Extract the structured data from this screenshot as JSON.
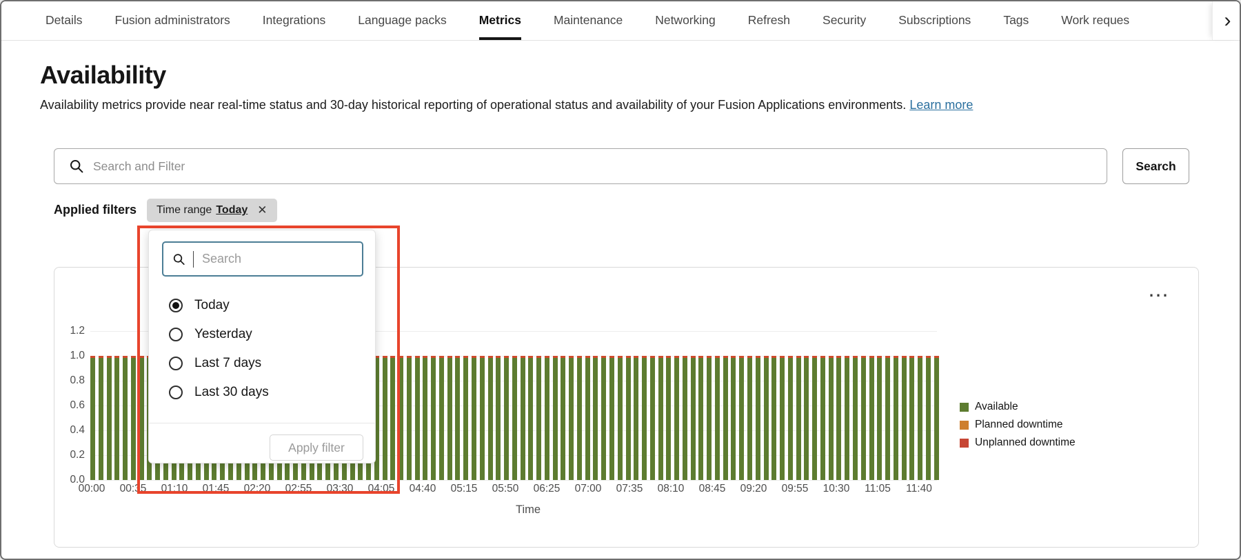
{
  "nav": {
    "tabs": [
      {
        "label": "Details",
        "active": false
      },
      {
        "label": "Fusion administrators",
        "active": false
      },
      {
        "label": "Integrations",
        "active": false
      },
      {
        "label": "Language packs",
        "active": false
      },
      {
        "label": "Metrics",
        "active": true
      },
      {
        "label": "Maintenance",
        "active": false
      },
      {
        "label": "Networking",
        "active": false
      },
      {
        "label": "Refresh",
        "active": false
      },
      {
        "label": "Security",
        "active": false
      },
      {
        "label": "Subscriptions",
        "active": false
      },
      {
        "label": "Tags",
        "active": false
      },
      {
        "label": "Work reques",
        "active": false
      }
    ],
    "overflow_icon": "chevron-right",
    "overflow_glyph": "›"
  },
  "header": {
    "title": "Availability",
    "description": "Availability metrics provide near real-time status and 30-day historical reporting of operational status and availability of your Fusion Applications environments.",
    "learn_more_label": "Learn more"
  },
  "search": {
    "placeholder": "Search and Filter",
    "button_label": "Search"
  },
  "filters": {
    "label": "Applied filters",
    "chip": {
      "prefix": "Time range",
      "value": "Today",
      "close_glyph": "✕"
    }
  },
  "filter_dropdown": {
    "search_placeholder": "Search",
    "options": [
      {
        "label": "Today",
        "selected": true
      },
      {
        "label": "Yesterday",
        "selected": false
      },
      {
        "label": "Last 7 days",
        "selected": false
      },
      {
        "label": "Last 30 days",
        "selected": false
      }
    ],
    "apply_label": "Apply filter",
    "apply_enabled": false
  },
  "chart_card": {
    "menu_glyph": "⋯",
    "menu_icon": "ellipsis-menu"
  },
  "chart_data": {
    "type": "bar",
    "title": "",
    "xlabel": "Time",
    "ylabel": "",
    "ylim": [
      0,
      1.2
    ],
    "yticks": [
      0.0,
      0.2,
      0.4,
      0.6,
      0.8,
      1.0,
      1.2
    ],
    "x_ticks": [
      "00:00",
      "00:35",
      "01:10",
      "01:45",
      "02:20",
      "02:55",
      "03:30",
      "04:05",
      "04:40",
      "05:15",
      "05:50",
      "06:25",
      "07:00",
      "07:35",
      "08:10",
      "08:45",
      "09:20",
      "09:55",
      "10:30",
      "11:05",
      "11:40"
    ],
    "interval_minutes": 5,
    "bar_count": 105,
    "series": [
      {
        "name": "Available",
        "color": "#5d7c30",
        "uniform_value": 1.0
      },
      {
        "name": "Planned downtime",
        "color": "#ce7f2e",
        "uniform_value": 0.0
      },
      {
        "name": "Unplanned downtime",
        "color": "#c74634",
        "uniform_value": 0.0
      }
    ],
    "grid": true,
    "legend_position": "right"
  },
  "annotation": {
    "type": "highlight-box",
    "color": "#e8442c"
  },
  "colors": {
    "available_green": "#5d7c30",
    "planned_orange": "#ce7f2e",
    "unplanned_red": "#c74634",
    "bar_top_cap": "#cf4a2c",
    "annotation_red": "#e8442c",
    "chip_background": "#d6d6d6",
    "link_blue": "#2a6f9e",
    "focus_teal": "#4b7d95"
  }
}
